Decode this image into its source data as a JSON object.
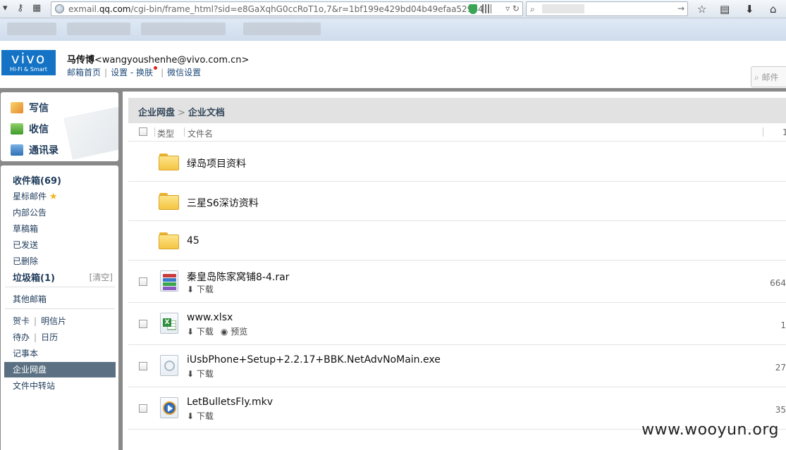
{
  "browser": {
    "url_prefix": "exmail.",
    "url_domain": "qq.com",
    "url_rest": "/cgi-bin/frame_html?sid=e8GaXqhG0ccRoT1o,7&r=1bf199e429bd04b49efaa52964"
  },
  "header": {
    "logo_main": "vivo",
    "logo_sub": "Hi-Fi & Smart",
    "user_name": "马传博",
    "user_email": "<wangyoushenhe@vivo.com.cn>",
    "links": [
      "邮箱首页",
      "设置",
      "换肤",
      "微信设置"
    ],
    "search_placeholder": "邮件"
  },
  "sidebar": {
    "quick": [
      "写信",
      "收信",
      "通讯录"
    ],
    "inbox": "收件箱(69)",
    "starred": "星标邮件",
    "items": [
      "内部公告",
      "草稿箱",
      "已发送",
      "已删除"
    ],
    "trash": "垃圾箱(1)",
    "trash_clear": "[清空]",
    "other_mail": "其他邮箱",
    "greeting": "贺卡",
    "postcard": "明信片",
    "todo": "待办",
    "calendar": "日历",
    "notes": "记事本",
    "netdisk": "企业网盘",
    "transfer": "文件中转站"
  },
  "content": {
    "breadcrumb_root": "企业网盘",
    "breadcrumb_current": "企业文档",
    "col_type": "类型",
    "col_name": "文件名",
    "col_size": "1",
    "download_label": "下载",
    "preview_label": "预览",
    "folders": [
      "绿岛项目资料",
      "三星S6深访资料",
      "45"
    ],
    "files": [
      {
        "name": "秦皇岛陈家窝铺8-4.rar",
        "size": "664",
        "icon": "rar-icon"
      },
      {
        "name": "www.xlsx",
        "size": "1",
        "icon": "xlsx-icon",
        "preview": true
      },
      {
        "name": "iUsbPhone+Setup+2.2.17+BBK.NetAdvNoMain.exe",
        "size": "27",
        "icon": "exe-icon"
      },
      {
        "name": "LetBulletsFly.mkv",
        "size": "35",
        "icon": "mkv-icon"
      }
    ]
  },
  "watermark": "www.wooyun.org"
}
